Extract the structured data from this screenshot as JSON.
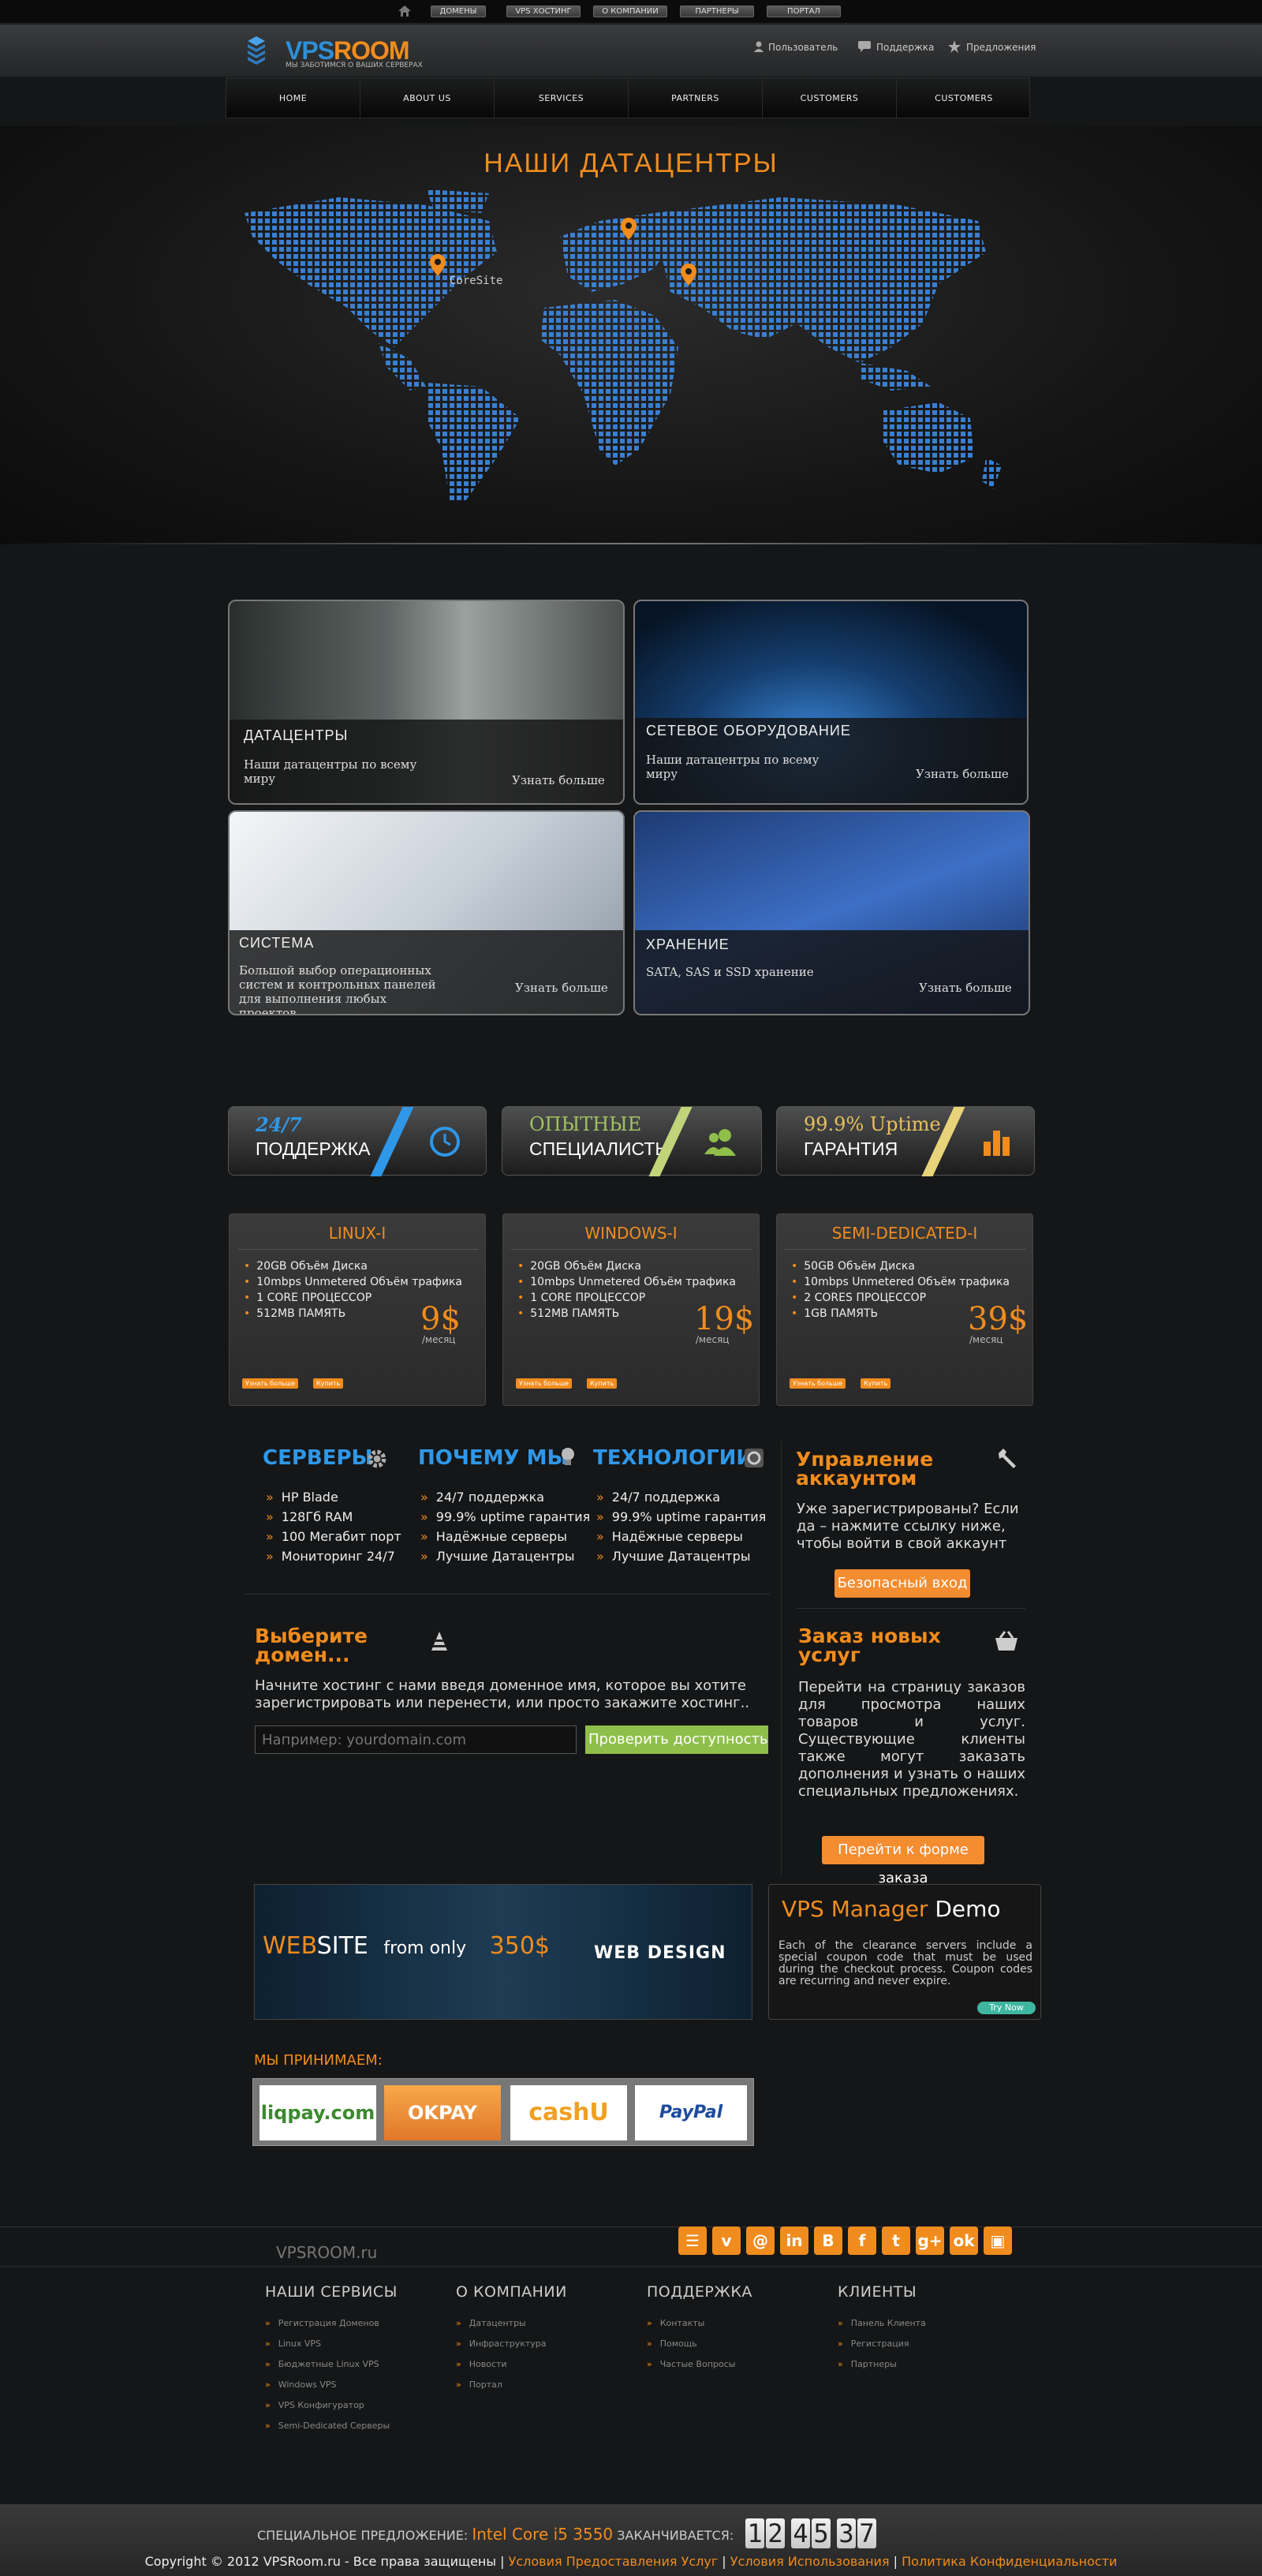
{
  "topbar": {
    "links": [
      "ДОМЕНЫ",
      "VPS ХОСТИНГ",
      "О КОМПАНИИ",
      "ПАРТНЕРЫ",
      "ПОРТАЛ"
    ]
  },
  "header": {
    "logo_vps": "VPS",
    "logo_room": "ROOM",
    "logo_tagline": "МЫ ЗАБОТИМСЯ О ВАШИХ СЕРВЕРАХ",
    "user_link": "Пользователь",
    "support_link": "Поддержка",
    "offers_link": "Предложения"
  },
  "nav": {
    "items": [
      "HOME",
      "ABOUT US",
      "SERVICES",
      "PARTNERS",
      "CUSTOMERS",
      "CUSTOMERS"
    ]
  },
  "map": {
    "title": "НАШИ ДАТАЦЕНТРЫ",
    "pin_label": "CoreSite"
  },
  "features": [
    {
      "title": "ДАТАЦЕНТРЫ",
      "desc": "Наши датацентры по всему миру",
      "more": "Узнать больше"
    },
    {
      "title": "СЕТЕВОЕ ОБОРУДОВАНИЕ",
      "desc": "Наши датацентры по всему миру",
      "more": "Узнать больше"
    },
    {
      "title": "СИСТЕМА",
      "desc": "Большой выбор операционных систем и контрольных панелей для выполнения любых проектов",
      "more": "Узнать больше"
    },
    {
      "title": "ХРАНЕНИЕ",
      "desc": "SATA, SAS и SSD хранение",
      "more": "Узнать больше"
    }
  ],
  "badges": [
    {
      "line1": "24/7",
      "line2": "ПОДДЕРЖКА"
    },
    {
      "line1": "ОПЫТНЫЕ",
      "line2": "СПЕЦИАЛИСТЫ"
    },
    {
      "line1": "99.9% Uptime",
      "line2": "ГАРАНТИЯ"
    }
  ],
  "plans": [
    {
      "title": "LINUX-I",
      "features": [
        "20GB Объём Диска",
        "10mbps Unmetered Объём трафика",
        "1 CORE ПРОЦЕССОР",
        "512MB ПАМЯТЬ"
      ],
      "price": "9$",
      "per": "/месяц",
      "btn1": "Узнать больше",
      "btn2": "Купить"
    },
    {
      "title": "WINDOWS-I",
      "features": [
        "20GB Объём Диска",
        "10mbps Unmetered Объём трафика",
        "1 CORE ПРОЦЕССОР",
        "512MB ПАМЯТЬ"
      ],
      "price": "19$",
      "per": "/месяц",
      "btn1": "Узнать больше",
      "btn2": "Купить"
    },
    {
      "title": "SEMI-DEDICATED-I",
      "features": [
        "50GB Объём Диска",
        "10mbps Unmetered Объём трафика",
        "2 CORES ПРОЦЕССОР",
        "1GB ПАМЯТЬ"
      ],
      "price": "39$",
      "per": "/месяц",
      "btn1": "Узнать больше",
      "btn2": "Купить"
    }
  ],
  "info": {
    "servers": {
      "title": "СЕРВЕРЫ",
      "items": [
        "HP Blade",
        "128Гб RAM",
        "100 Мегабит порт",
        "Мониторинг 24/7"
      ]
    },
    "why": {
      "title": "ПОЧЕМУ МЫ",
      "items": [
        "24/7 поддержка",
        "99.9% uptime гарантия",
        "Надёжные серверы",
        "Лучшие Датацентры"
      ]
    },
    "tech": {
      "title": "ТЕХНОЛОГИИ",
      "items": [
        "24/7 поддержка",
        "99.9% uptime гарантия",
        "Надёжные серверы",
        "Лучшие Датацентры"
      ]
    }
  },
  "account": {
    "title1": "Управление",
    "title2": "аккаунтом",
    "text": "Уже зарегистрированы? Если да – нажмите ссылку ниже, чтобы войти в свой аккаунт",
    "button": "Безопасный вход"
  },
  "domain": {
    "title1": "Выберите",
    "title2": "домен...",
    "text": "Начните хостинг с нами введя доменное имя, которое вы хотите зарегистрировать или перенести, или просто закажите хостинг..",
    "placeholder": "Например: yourdomain.com",
    "button": "Проверить доступность"
  },
  "order": {
    "title1": "Заказ новых",
    "title2": "услуг",
    "text": "Перейти на страницу заказов для просмотра наших товаров и услуг. Существующие клиенты также могут заказать дополнения и узнать о наших специальных предложениях.",
    "button": "Перейти к форме заказа"
  },
  "banner": {
    "web": "WEB",
    "site": "SITE",
    "from": "from only",
    "price": "350$",
    "big": "WEB DESIGN"
  },
  "vpsmanager": {
    "title1": "VPS Manager",
    "title2": "Demo",
    "text": "Each of the clearance servers include a special coupon code that must be used during the checkout process. Coupon codes are recurring and never expire.",
    "button": "Try Now"
  },
  "payments": {
    "title": "МЫ ПРИНИМАЕМ:",
    "items": [
      "liqpay.com",
      "OKPAY",
      "cashU",
      "PayPal"
    ]
  },
  "footer": {
    "brand": "VPSROOM.ru",
    "columns": [
      {
        "title": "НАШИ СЕРВИСЫ",
        "items": [
          "Регистрация Доменов",
          "Linux VPS",
          "Бюджетные Linux VPS",
          "Windows VPS",
          "VPS Конфигуратор",
          "Semi-Dedicated Серверы"
        ]
      },
      {
        "title": "О КОМПАНИИ",
        "items": [
          "Датацентры",
          "Инфраструктура",
          "Новости",
          "Портал"
        ]
      },
      {
        "title": "ПОДДЕРЖКА",
        "items": [
          "Контакты",
          "Помощь",
          "Частые Вопросы"
        ]
      },
      {
        "title": "КЛИЕНТЫ",
        "items": [
          "Панель Клиента",
          "Регистрация",
          "Партнеры"
        ]
      }
    ],
    "special_label": "СПЕЦИАЛЬНОЕ ПРЕДЛОЖЕНИЕ:",
    "special_product": "Intel Core i5 3550",
    "ends": "ЗАКАНЧИВАЕТСЯ:",
    "countdown": [
      "1",
      "2",
      "4",
      "5",
      "3",
      "7"
    ],
    "copyright": "Copyright © 2012 VPSRoom.ru - Все права защищены |",
    "links": [
      "Условия Предоставления Услуг",
      "Условия Использования",
      "Политика Конфиденциальности"
    ]
  },
  "colors": {
    "accent": "#f08c1e",
    "blue": "#2f97e8",
    "map_dot": "#3a7fd0"
  }
}
